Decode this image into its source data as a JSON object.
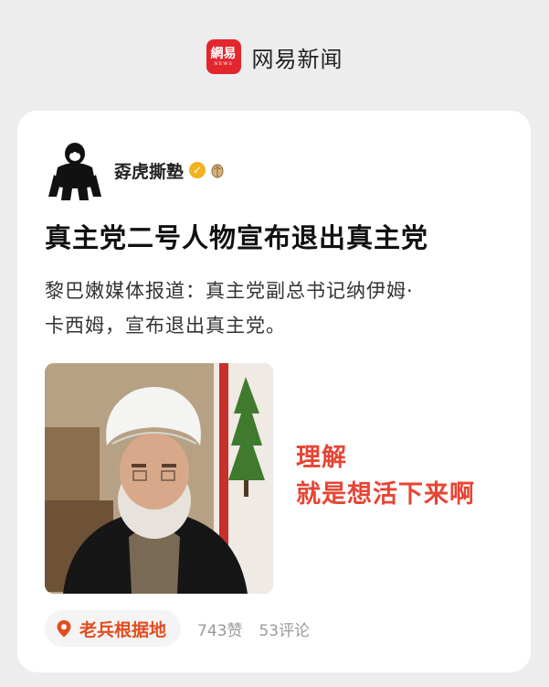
{
  "brand": {
    "logo_text": "網易",
    "logo_subtext": "NEWS",
    "name": "网易新闻",
    "color": "#e3262d"
  },
  "post": {
    "author": "孬虎撕塾",
    "verified_icon": "verified-check-icon",
    "badge_icon": "seed-badge-icon",
    "headline": "真主党二号人物宣布退出真主党",
    "summary_lines": [
      "黎巴嫩媒体报道：真主党副总书记纳伊姆·",
      "卡西姆，宣布退出真主党。"
    ],
    "image_overlay": [
      "理解",
      "就是想活下来啊"
    ],
    "overlay_color": "#e64534"
  },
  "footer": {
    "location_icon": "location-pin-icon",
    "location": "老兵根据地",
    "likes": "743赞",
    "comments": "53评论",
    "location_color": "#e24d20"
  }
}
